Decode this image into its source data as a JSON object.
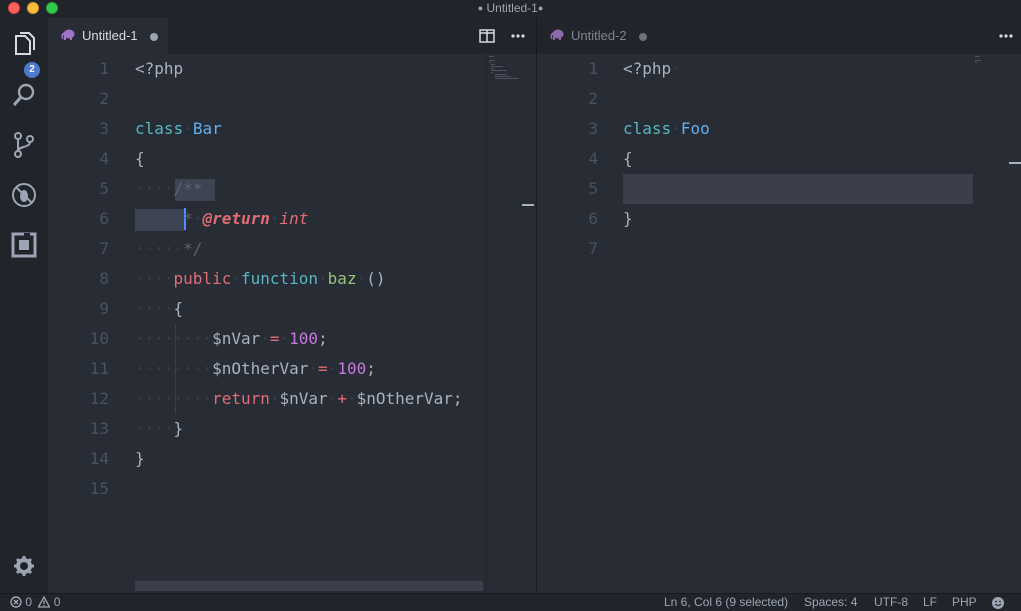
{
  "window": {
    "title": "Untitled-1",
    "dirty_marker": "●"
  },
  "activity": {
    "explorer_badge": "2",
    "icons": [
      "files-icon",
      "search-icon",
      "source-control-icon",
      "debug-icon",
      "extensions-icon",
      "settings-gear-icon"
    ]
  },
  "editor1": {
    "tab_label": "Untitled-1",
    "tab_icon": "php-elephant-icon",
    "line_numbers": [
      "1",
      "2",
      "3",
      "4",
      "5",
      "6",
      "7",
      "8",
      "9",
      "10",
      "11",
      "12",
      "13",
      "14",
      "15"
    ]
  },
  "editor2": {
    "tab_label": "Untitled-2",
    "tab_icon": "php-elephant-icon",
    "line_numbers": [
      "1",
      "2",
      "3",
      "4",
      "5",
      "6",
      "7"
    ]
  },
  "code1": {
    "l1_tag": "<?php",
    "l3_kw": "class",
    "l3_name": "Bar",
    "l4": "{",
    "l5_ws": "····",
    "l5_com": "/**",
    "l6_ws": "·····",
    "l6_star": "*",
    "l6_ann": "@return",
    "l6_type": "int",
    "l7_ws": "·····",
    "l7_com": "*/",
    "l8_ws": "····",
    "l8_mod": "public",
    "l8_kw": "function",
    "l8_fn": "baz",
    "l8_paren": "()",
    "l9_ws": "····",
    "l9": "{",
    "l10_ws": "········",
    "l10_var": "$nVar",
    "l10_op": "=",
    "l10_num": "100",
    "l10_semi": ";",
    "l11_ws": "········",
    "l11_var": "$nOtherVar",
    "l11_op": "=",
    "l11_num": "100",
    "l11_semi": ";",
    "l12_ws": "········",
    "l12_kw": "return",
    "l12_var1": "$nVar",
    "l12_op": "+",
    "l12_var2": "$nOtherVar",
    "l12_semi": ";",
    "l13_ws": "····",
    "l13": "}",
    "l14": "}"
  },
  "code2": {
    "l1_tag": "<?php",
    "l3_kw": "class",
    "l3_name": "Foo",
    "l4": "{",
    "l5_ws": "····",
    "l6": "}"
  },
  "status": {
    "errors": "0",
    "warnings": "0",
    "position": "Ln 6, Col 6 (9 selected)",
    "indent": "Spaces: 4",
    "encoding": "UTF-8",
    "eol": "LF",
    "language": "PHP",
    "feedback_icon": "smiley-icon"
  },
  "colors": {
    "background": "#282c34",
    "chrome": "#21252b",
    "badge": "#4d78cc",
    "cursor": "#528bff"
  }
}
